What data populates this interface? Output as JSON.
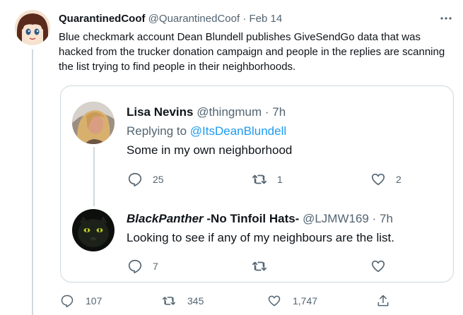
{
  "tweet": {
    "display_name": "QuarantinedCoof",
    "handle": "@QuarantinedCoof",
    "separator": "·",
    "date": "Feb 14",
    "text": "Blue checkmark account Dean Blundell publishes GiveSendGo data that was hacked from the trucker donation campaign and people in the replies are scanning the list trying to find people in their neighborhoods.",
    "replies": "107",
    "retweets": "345",
    "likes": "1,747"
  },
  "quoted_replies": [
    {
      "display_name": "Lisa Nevins",
      "handle": "@thingmum",
      "separator": "·",
      "time": "7h",
      "replying_prefix": "Replying to",
      "replying_to": "@ItsDeanBlundell",
      "text": "Some in my own neighborhood",
      "replies": "25",
      "retweets": "1",
      "likes": "2"
    },
    {
      "display_name_styled": "BlackPanther",
      "display_name_rest": " -No Tinfoil Hats-",
      "handle": "@LJMW169",
      "separator": "·",
      "time": "7h",
      "text": "Looking to see if any of my neighbours are the list.",
      "replies": "7",
      "retweets": "",
      "likes": ""
    }
  ],
  "colors": {
    "accent": "#1d9bf0",
    "muted": "#536471",
    "border": "#cfd9de"
  },
  "icons": [
    "more-icon",
    "reply-icon",
    "retweet-icon",
    "like-icon",
    "share-icon"
  ]
}
